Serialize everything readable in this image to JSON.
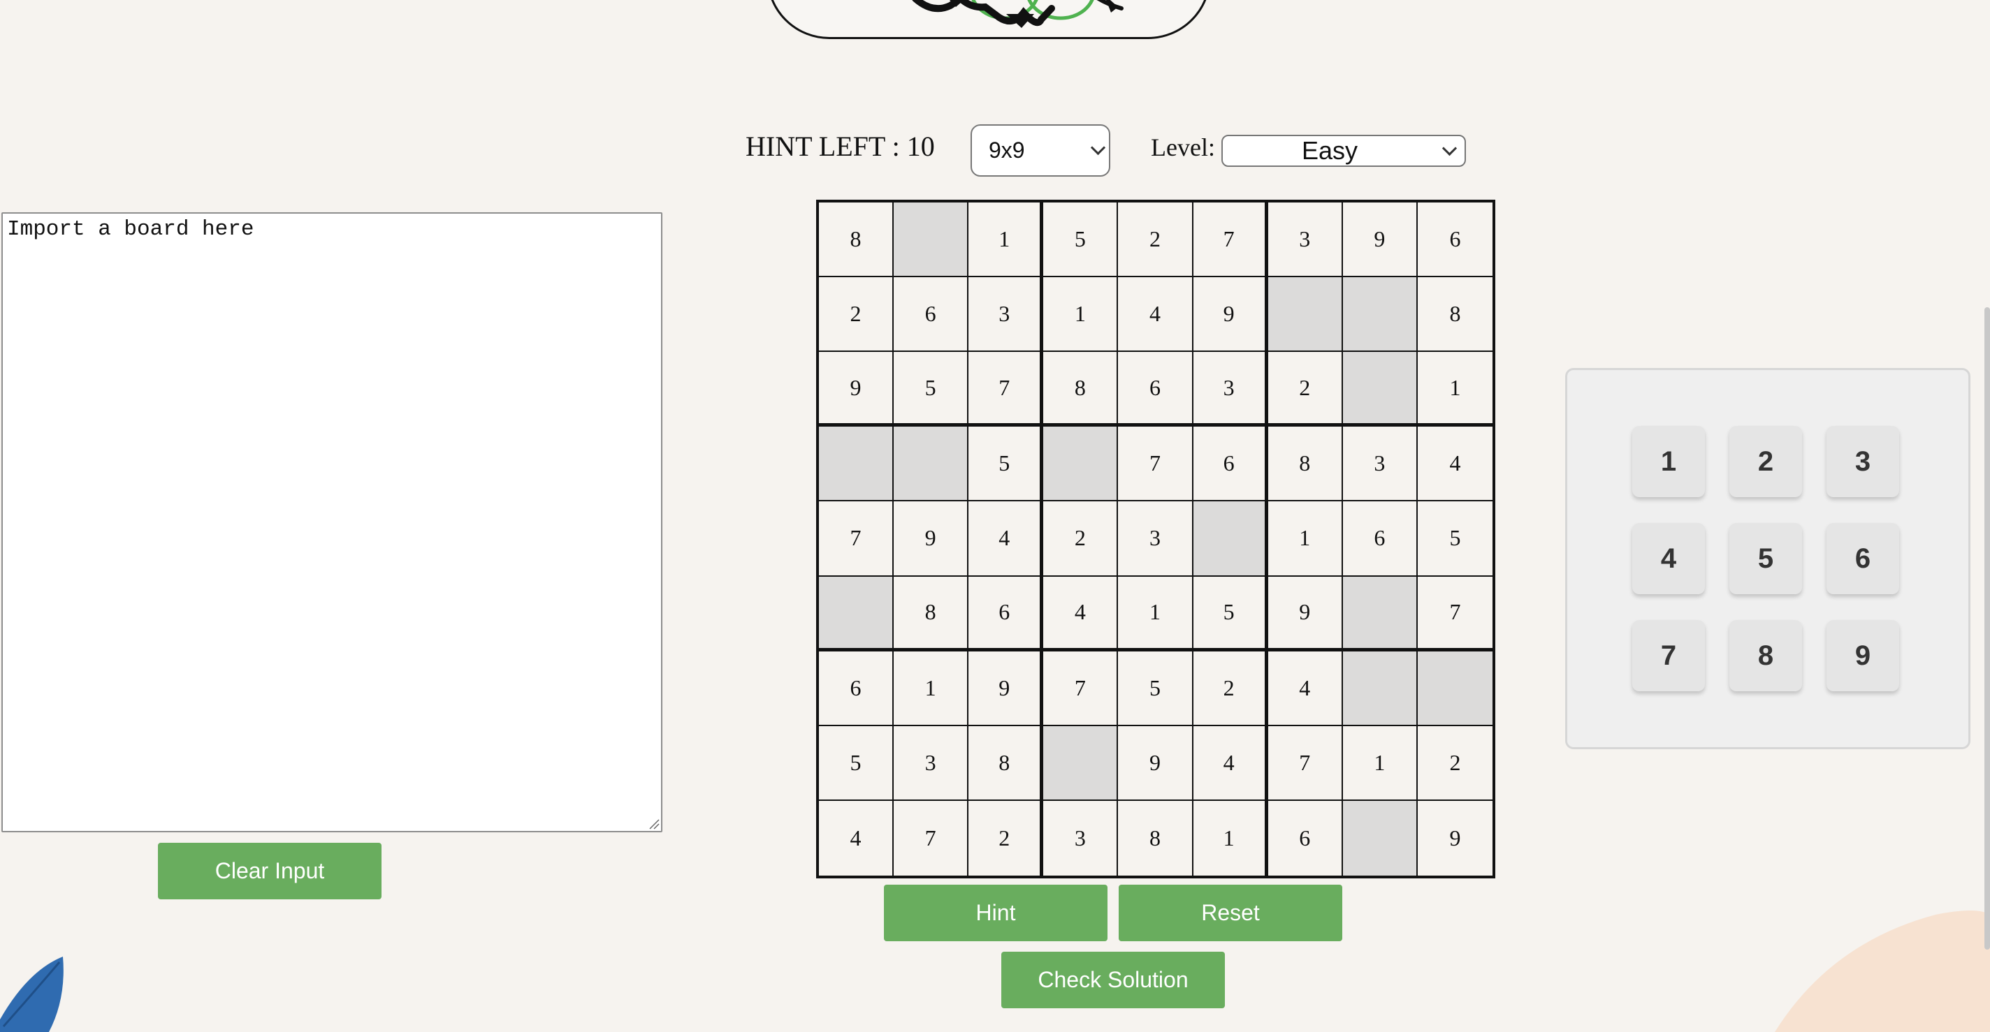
{
  "header": {
    "hint_label": "HINT LEFT :",
    "hint_count": "10"
  },
  "size_select": {
    "selected": "9x9"
  },
  "level": {
    "label": "Level:",
    "selected": "Easy"
  },
  "import_panel": {
    "value": "Import a board here",
    "clear_label": "Clear Input"
  },
  "board": {
    "cells": [
      [
        "8",
        "",
        "1",
        "5",
        "2",
        "7",
        "3",
        "9",
        "6"
      ],
      [
        "2",
        "6",
        "3",
        "1",
        "4",
        "9",
        "",
        "",
        "8"
      ],
      [
        "9",
        "5",
        "7",
        "8",
        "6",
        "3",
        "2",
        "",
        "1"
      ],
      [
        "",
        "",
        "5",
        "",
        "7",
        "6",
        "8",
        "3",
        "4"
      ],
      [
        "7",
        "9",
        "4",
        "2",
        "3",
        "",
        "1",
        "6",
        "5"
      ],
      [
        "",
        "8",
        "6",
        "4",
        "1",
        "5",
        "9",
        "",
        "7"
      ],
      [
        "6",
        "1",
        "9",
        "7",
        "5",
        "2",
        "4",
        "",
        ""
      ],
      [
        "5",
        "3",
        "8",
        "",
        "9",
        "4",
        "7",
        "1",
        "2"
      ],
      [
        "4",
        "7",
        "2",
        "3",
        "8",
        "1",
        "6",
        "",
        "9"
      ]
    ]
  },
  "controls": {
    "hint_label": "Hint",
    "reset_label": "Reset",
    "check_label": "Check Solution"
  },
  "numpad": {
    "keys": [
      "1",
      "2",
      "3",
      "4",
      "5",
      "6",
      "7",
      "8",
      "9"
    ]
  },
  "colors": {
    "button_green": "#69ad5e",
    "page_background": "#f6f3ef",
    "empty_cell": "#dcdbda",
    "numpad_background": "#efefef"
  },
  "icons": {
    "logo": "frog-logo-icon",
    "leaf": "leaf-icon",
    "select_arrow": "chevron-down-icon"
  }
}
